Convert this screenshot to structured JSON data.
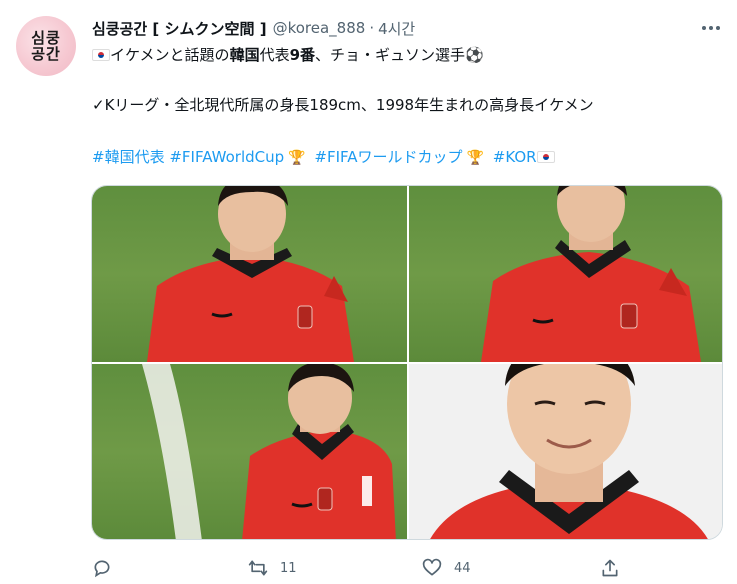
{
  "author": {
    "avatar_text_1": "심쿵",
    "avatar_text_2": "공간",
    "name": "심쿵공간 [ シムクン空間 ]",
    "handle": "@korea_888",
    "separator": "·",
    "time": "4시간"
  },
  "tweet": {
    "line1_a": "イケメンと話題の",
    "line1_bold": "韓国",
    "line1_b": "代表",
    "line1_bold2": "9番",
    "line1_c": "、チョ・ギュソン選手",
    "line1_emoji": "⚽",
    "line2_check": "✓",
    "line2_text": "Kリーグ・全北現代所属の身長189cm、1998年生まれの高身長イケメン",
    "hashtags": [
      "#韓国代表",
      "#FIFAWorldCup",
      "#FIFAワールドカップ",
      "#KOR"
    ],
    "trophy": "🏆"
  },
  "actions": {
    "reply_count": "",
    "retweet_count": "11",
    "like_count": "44"
  },
  "colors": {
    "link": "#1d9bf0",
    "secondary": "#536471",
    "jersey_red": "#e0322a"
  },
  "icons": [
    "more-icon",
    "reply-icon",
    "retweet-icon",
    "like-icon",
    "share-icon",
    "korea-flag-icon",
    "trophy-icon",
    "soccer-ball-icon"
  ]
}
